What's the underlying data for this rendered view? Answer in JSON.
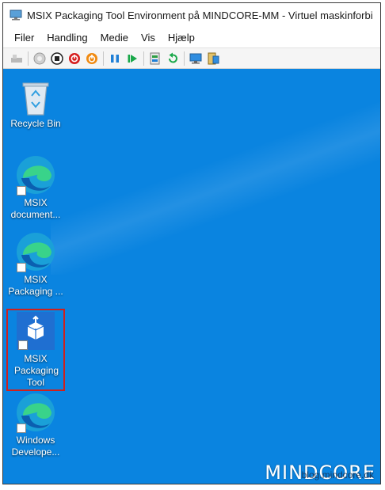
{
  "window": {
    "title": "MSIX Packaging Tool Environment på MINDCORE-MM - Virtuel maskinforbi"
  },
  "menu": {
    "items": [
      "Filer",
      "Handling",
      "Medie",
      "Vis",
      "Hjælp"
    ]
  },
  "toolbar": {
    "buttons": [
      {
        "name": "ctrl-alt-del-icon"
      },
      {
        "name": "start-icon"
      },
      {
        "name": "turn-off-icon"
      },
      {
        "name": "shutdown-icon"
      },
      {
        "name": "power-icon"
      },
      {
        "name": "pause-icon"
      },
      {
        "name": "resume-icon"
      },
      {
        "name": "checkpoint-icon"
      },
      {
        "name": "revert-icon"
      },
      {
        "name": "enhanced-session-icon"
      },
      {
        "name": "share-icon"
      }
    ]
  },
  "desktop": {
    "icons": [
      {
        "label": "Recycle Bin",
        "kind": "recycle-bin"
      },
      {
        "label": "MSIX document...",
        "kind": "edge"
      },
      {
        "label": "MSIX Packaging ...",
        "kind": "edge"
      },
      {
        "label": "MSIX Packaging Tool",
        "kind": "msix-tool",
        "selected": true
      },
      {
        "label": "Windows Develope...",
        "kind": "edge"
      }
    ]
  },
  "watermark": {
    "text": "MINDCORE",
    "subtext": "blog.mindcore.dk"
  },
  "colors": {
    "desktop": "#0a84e0",
    "selection": "#d0201c"
  }
}
